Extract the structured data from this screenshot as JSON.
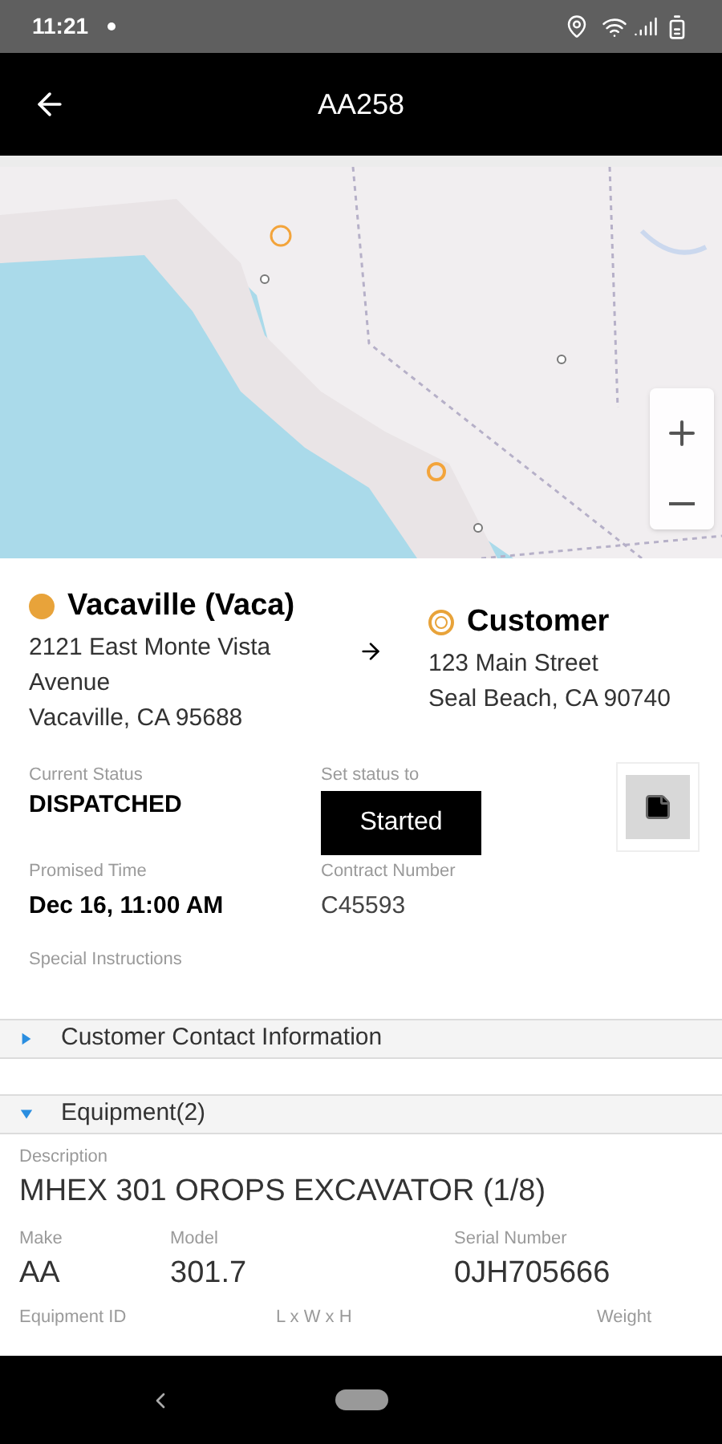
{
  "status_bar": {
    "time": "11:21"
  },
  "header": {
    "title": "AA258"
  },
  "route": {
    "origin": {
      "name": "Vacaville (Vaca)",
      "color": "#e8a33a",
      "address_lines": [
        "2121 East Monte Vista Avenue",
        "Vacaville, CA 95688"
      ]
    },
    "destination": {
      "name": "Customer",
      "color": "#e8a33a",
      "address_lines": [
        "123 Main Street",
        "Seal Beach, CA 90740"
      ]
    }
  },
  "status": {
    "current_label": "Current Status",
    "current_value": "DISPATCHED",
    "set_label": "Set status to",
    "set_button": "Started"
  },
  "details": [
    {
      "label": "Promised Time",
      "value": "Dec 16, 11:00 AM",
      "bold": true
    },
    {
      "label": "Contract Number",
      "value": "C45593",
      "bold": false
    }
  ],
  "special_instructions": {
    "label": "Special Instructions"
  },
  "sections": [
    {
      "title": "Customer Contact Information",
      "expanded": false
    },
    {
      "title": "Equipment(2)",
      "expanded": true
    }
  ],
  "equipment": {
    "description_label": "Description",
    "description": "MHEX 301 OROPS EXCAVATOR (1/8)",
    "row_1": [
      {
        "label": "Make",
        "value": "AA"
      },
      {
        "label": "Model",
        "value": "301.7"
      },
      {
        "label": "Serial Number",
        "value": "0JH705666"
      }
    ],
    "row_2": [
      {
        "label": "Equipment ID"
      },
      {
        "label": "L x W x H"
      },
      {
        "label": "Weight"
      }
    ]
  }
}
